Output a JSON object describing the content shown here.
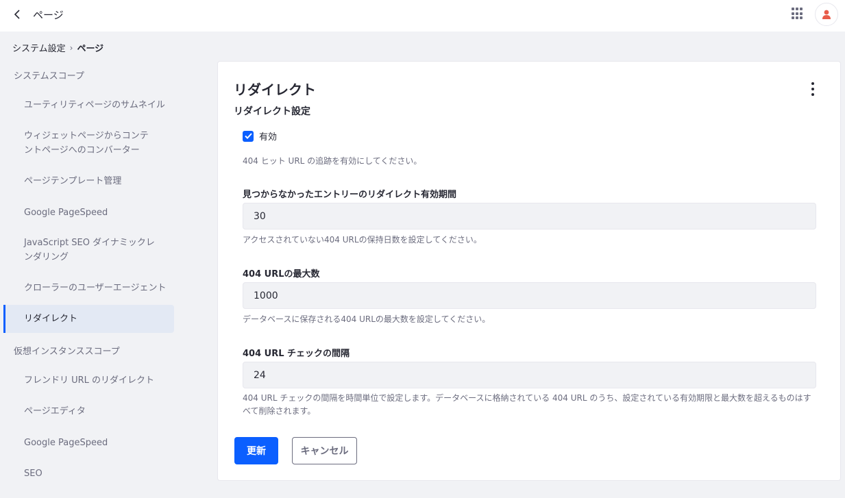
{
  "header": {
    "title": "ページ",
    "back_icon": "chevron-left-icon",
    "apps_icon": "grid-icon",
    "avatar_icon": "user-icon",
    "avatar_color": "#e85c4a"
  },
  "breadcrumb": {
    "parent": "システム設定",
    "current": "ページ"
  },
  "sidebar": {
    "system_scope": {
      "title": "システムスコープ",
      "items": [
        {
          "label": "ユーティリティページのサムネイル"
        },
        {
          "label": "ウィジェットページからコンテントページへのコンバーター"
        },
        {
          "label": "ページテンプレート管理"
        },
        {
          "label": "Google PageSpeed"
        },
        {
          "label": "JavaScript SEO ダイナミックレンダリング"
        },
        {
          "label": "クローラーのユーザーエージェント"
        },
        {
          "label": "リダイレクト",
          "active": true
        }
      ]
    },
    "instance_scope": {
      "title": "仮想インスタンススコープ",
      "items": [
        {
          "label": "フレンドリ URL のリダイレクト"
        },
        {
          "label": "ページエディタ"
        },
        {
          "label": "Google PageSpeed"
        },
        {
          "label": "SEO"
        }
      ]
    }
  },
  "main": {
    "title": "リダイレクト",
    "section_title": "リダイレクト設定",
    "enabled": {
      "label": "有効",
      "checked": true,
      "help": "404 ヒット URL の追跡を有効にしてください。"
    },
    "fields": [
      {
        "label": "見つからなかったエントリーのリダイレクト有効期間",
        "value": "30",
        "help": "アクセスされていない404 URLの保持日数を設定してください。"
      },
      {
        "label": "404 URLの最大数",
        "value": "1000",
        "help": "データベースに保存される404 URLの最大数を設定してください。"
      },
      {
        "label": "404 URL チェックの間隔",
        "value": "24",
        "help": "404 URL チェックの間隔を時間単位で設定します。データベースに格納されている 404 URL のうち、設定されている有効期限と最大数を超えるものはすべて削除されます。"
      }
    ],
    "buttons": {
      "save": "更新",
      "cancel": "キャンセル"
    }
  },
  "colors": {
    "accent": "#0b5fff",
    "active_nav_bg": "#e3e9f4"
  }
}
